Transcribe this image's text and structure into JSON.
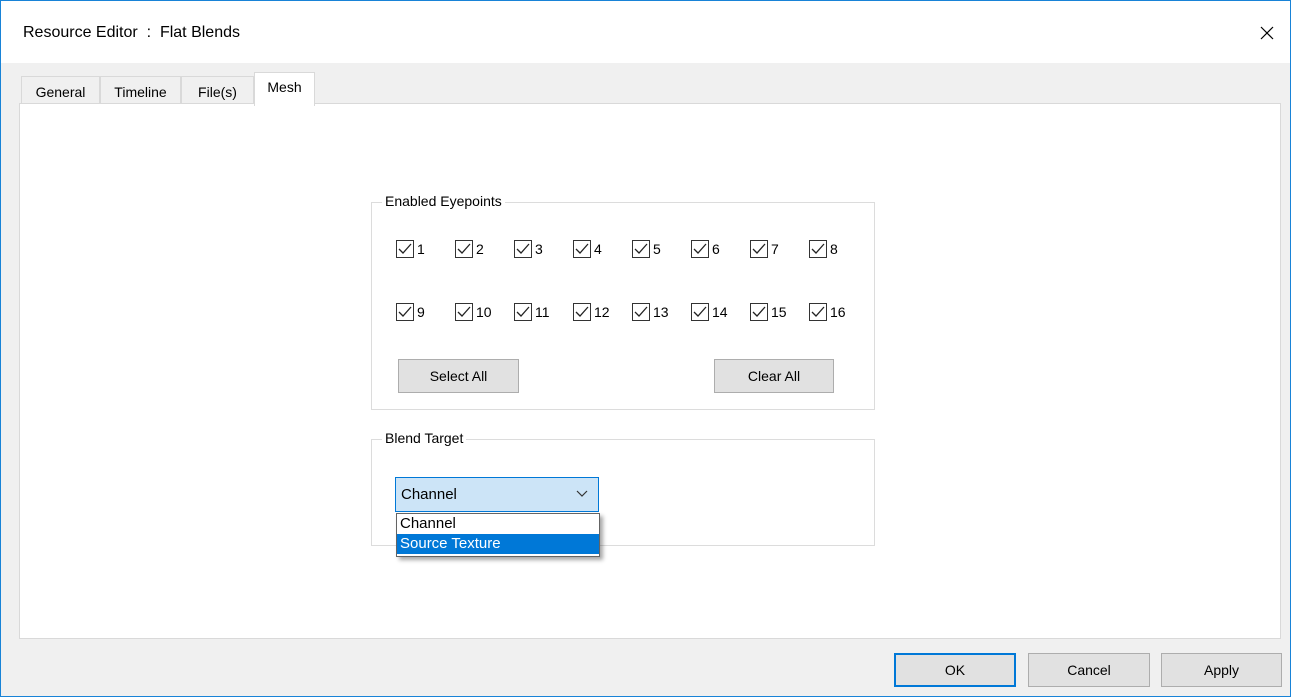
{
  "window": {
    "title": "Resource Editor  :  Flat Blends"
  },
  "tabs": [
    {
      "label": "General"
    },
    {
      "label": "Timeline"
    },
    {
      "label": "File(s)"
    },
    {
      "label": "Mesh"
    }
  ],
  "active_tab": "Mesh",
  "eyepoints": {
    "group_label": "Enabled Eyepoints",
    "items": [
      {
        "label": "1",
        "checked": true
      },
      {
        "label": "2",
        "checked": true
      },
      {
        "label": "3",
        "checked": true
      },
      {
        "label": "4",
        "checked": true
      },
      {
        "label": "5",
        "checked": true
      },
      {
        "label": "6",
        "checked": true
      },
      {
        "label": "7",
        "checked": true
      },
      {
        "label": "8",
        "checked": true
      },
      {
        "label": "9",
        "checked": true
      },
      {
        "label": "10",
        "checked": true
      },
      {
        "label": "11",
        "checked": true
      },
      {
        "label": "12",
        "checked": true
      },
      {
        "label": "13",
        "checked": true
      },
      {
        "label": "14",
        "checked": true
      },
      {
        "label": "15",
        "checked": true
      },
      {
        "label": "16",
        "checked": true
      }
    ],
    "select_all_label": "Select All",
    "clear_all_label": "Clear All"
  },
  "blend_target": {
    "group_label": "Blend Target",
    "selected_value": "Channel",
    "options": [
      "Channel",
      "Source Texture"
    ],
    "highlighted_option": "Source Texture"
  },
  "footer": {
    "ok_label": "OK",
    "cancel_label": "Cancel",
    "apply_label": "Apply"
  },
  "colors": {
    "accent": "#0078d7",
    "window_border": "#1883d7",
    "select_bg": "#cce4f7"
  }
}
